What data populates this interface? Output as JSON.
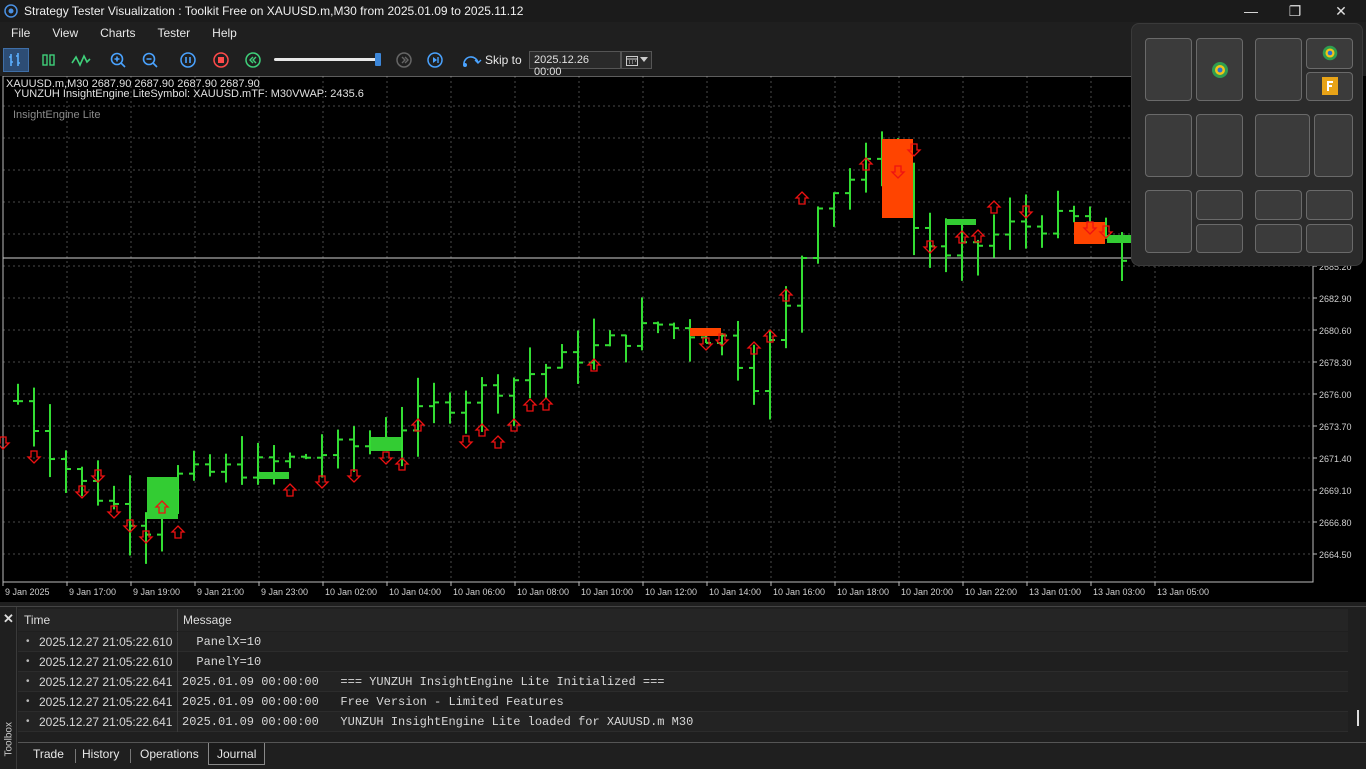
{
  "window": {
    "title": "Strategy Tester Visualization : Toolkit Free on XAUUSD.m,M30 from 2025.01.09 to 2025.11.12",
    "minimize_glyph": "—",
    "maximize_glyph": "❐",
    "close_glyph": "✕"
  },
  "menu": [
    "File",
    "View",
    "Charts",
    "Tester",
    "Help"
  ],
  "toolbar": {
    "icons": [
      "bar-chart-icon",
      "candlestick-icon",
      "line-chart-icon",
      "zoom-in-icon",
      "zoom-out-icon",
      "pause-icon",
      "stop-icon",
      "step-back-icon",
      "step-forward-icon",
      "play-icon",
      "skip-icon"
    ],
    "speed_slider_value": 0.97,
    "skip_label": "Skip to",
    "skip_date": "2025.12.26 00:00"
  },
  "chart": {
    "symbol_info": "XAUUSD.m,M30  2687.90 2687.90 2687.90 2687.90",
    "indicator_info": "YUNZUH InsightEngine LiteSymbol: XAUUSD.mTF: M30VWAP: 2435.6",
    "indicator_name": "InsightEngine Lite",
    "bar_color": "#33dd33",
    "zone_up_color": "#33cc33",
    "zone_down_color": "#ff4400",
    "arrow_color": "#ee1111",
    "price_ticks": [
      "2685.20",
      "2682.90",
      "2680.60",
      "2678.30",
      "2676.00",
      "2673.70",
      "2671.40",
      "2669.10",
      "2666.80",
      "2664.50"
    ],
    "time_ticks": [
      "9 Jan 2025",
      "9 Jan 17:00",
      "9 Jan 19:00",
      "9 Jan 21:00",
      "9 Jan 23:00",
      "10 Jan 02:00",
      "10 Jan 04:00",
      "10 Jan 06:00",
      "10 Jan 08:00",
      "10 Jan 10:00",
      "10 Jan 12:00",
      "10 Jan 14:00",
      "10 Jan 16:00",
      "10 Jan 18:00",
      "10 Jan 20:00",
      "10 Jan 22:00",
      "13 Jan 01:00",
      "13 Jan 03:00",
      "13 Jan 05:00"
    ]
  },
  "journal": {
    "columns": [
      "Time",
      "Message"
    ],
    "rows": [
      {
        "time": "2025.12.27 21:05:22.610",
        "message": "PanelX=10"
      },
      {
        "time": "2025.12.27 21:05:22.610",
        "message": "PanelY=10"
      },
      {
        "time": "2025.12.27 21:05:22.641",
        "message": "2025.01.09 00:00:00   === YUNZUH InsightEngine Lite Initialized ==="
      },
      {
        "time": "2025.12.27 21:05:22.641",
        "message": "2025.01.09 00:00:00   Free Version - Limited Features"
      },
      {
        "time": "2025.12.27 21:05:22.641",
        "message": "2025.01.09 00:00:00   YUNZUH InsightEngine Lite loaded for XAUUSD.m M30"
      }
    ]
  },
  "toolbox": {
    "label": "Toolbox",
    "close_glyph": "✕",
    "tabs": [
      "Trade",
      "History",
      "Operations",
      "Journal"
    ],
    "active_tab": "Journal"
  }
}
